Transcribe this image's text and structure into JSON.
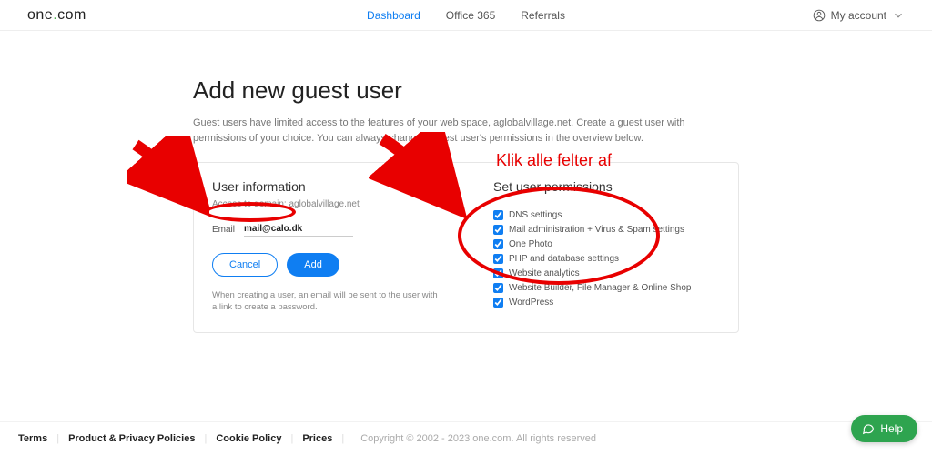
{
  "header": {
    "logo_pre": "one",
    "logo_dot": ".",
    "logo_post": "com",
    "nav": {
      "dashboard": "Dashboard",
      "office365": "Office 365",
      "referrals": "Referrals"
    },
    "account_label": "My account"
  },
  "page": {
    "title": "Add new guest user",
    "description": "Guest users have limited access to the features of your web space, aglobalvillage.net. Create a guest user with permissions of your choice. You can always change a guest user's permissions in the overview below."
  },
  "user_info": {
    "heading": "User information",
    "access_line": "Access to domain: aglobalvillage.net",
    "email_label": "Email",
    "email_value": "mail@calo.dk",
    "cancel_label": "Cancel",
    "add_label": "Add",
    "note": "When creating a user, an email will be sent to the user with a link to create a password."
  },
  "permissions": {
    "heading": "Set user permissions",
    "items": [
      "DNS settings",
      "Mail administration + Virus & Spam settings",
      "One Photo",
      "PHP and database settings",
      "Website analytics",
      "Website Builder, File Manager & Online Shop",
      "WordPress"
    ]
  },
  "footer": {
    "terms": "Terms",
    "privacy": "Product & Privacy Policies",
    "cookie": "Cookie Policy",
    "prices": "Prices",
    "copyright": "Copyright © 2002 - 2023 one.com. All rights reserved"
  },
  "help": {
    "label": "Help"
  },
  "annotations": {
    "headline": "Klik alle felter af"
  }
}
